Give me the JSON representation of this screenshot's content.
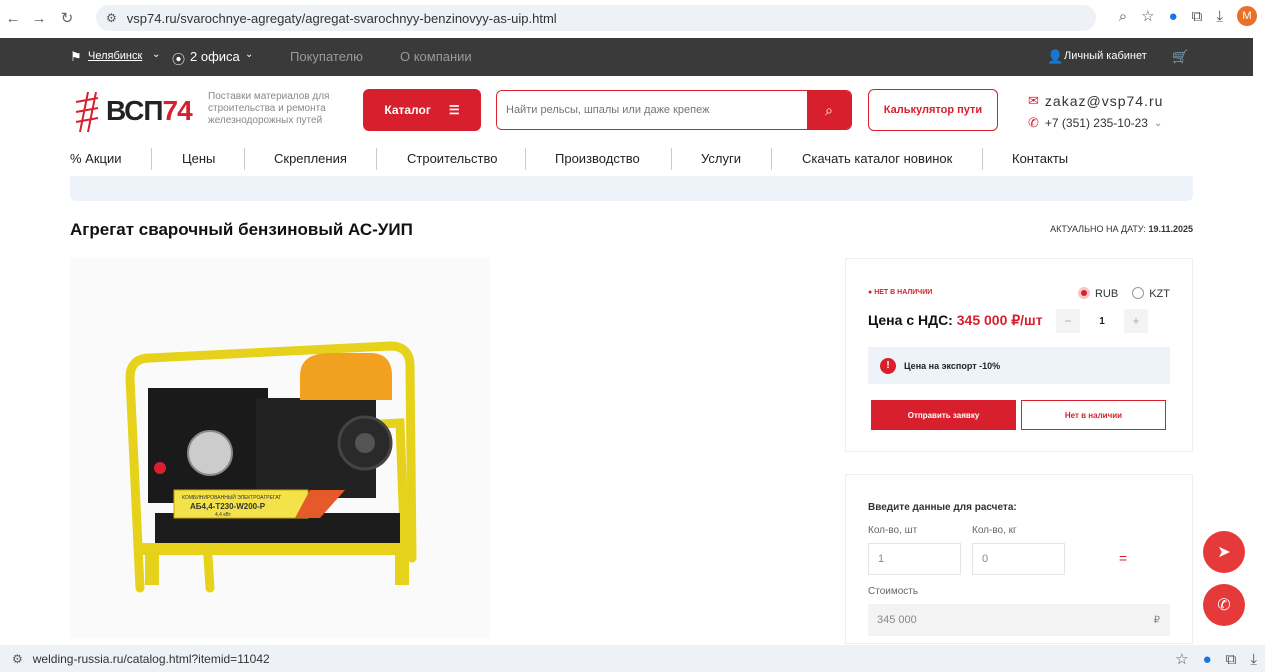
{
  "browser": {
    "url": "vsp74.ru/svarochnye-agregaty/agregat-svarochnyy-benzinovyy-as-uip.html",
    "status_url": "welding-russia.ru/catalog.html?itemid=11042",
    "avatar_letter": "M"
  },
  "topnav": {
    "city": "Челябинск",
    "offices": "2 офиса",
    "buyer": "Покупателю",
    "about": "О компании",
    "account": "Личный кабинет"
  },
  "header": {
    "logo_prefix": "ВСП",
    "logo_suffix": "74",
    "tagline": "Поставки материалов для строительства и ремонта железнодорожных путей",
    "catalog_label": "Каталог",
    "search_placeholder": "Найти рельсы, шпалы или даже крепеж",
    "calc_label": "Калькулятор пути",
    "email": "zakaz@vsp74.ru",
    "phone": "+7 (351) 235-10-23"
  },
  "menu": [
    "% Акции",
    "Цены",
    "Скрепления",
    "Строительство",
    "Производство",
    "Услуги",
    "Скачать каталог новинок",
    "Контакты"
  ],
  "product": {
    "title": "Агрегат сварочный бензиновый АС-УИП",
    "date_label": "АКТУАЛЬНО НА ДАТУ:",
    "date_value": "19.11.2025",
    "plate_line1": "КОМБИНИРОВАННЫЙ ЭЛЕКТРОАГРЕГАТ",
    "plate_line2": "АБ4,4-Т230-W200-Р",
    "plate_line3": "4,4 кВт"
  },
  "price": {
    "status": "НЕТ В НАЛИЧИИ",
    "currency_1": "RUB",
    "currency_2": "KZT",
    "price_label": "Цена с НДС:",
    "price_value": "345 000 ₽/шт",
    "qty": "1",
    "export_note": "Цена на экспорт -10%",
    "send_label": "Отправить заявку",
    "na_label": "Нет в наличии"
  },
  "calc": {
    "heading": "Введите данные для расчета:",
    "qty_label": "Кол-во, шт",
    "kg_label": "Кол-во, кг",
    "qty_value": "1",
    "kg_value": "0",
    "eq": "=",
    "cost_label": "Стоимость",
    "cost_value": "345 000",
    "cost_currency": "₽"
  },
  "colors": {
    "accent": "#d81f2d",
    "topbar": "#3a3a3a",
    "band": "#eef3fa"
  }
}
